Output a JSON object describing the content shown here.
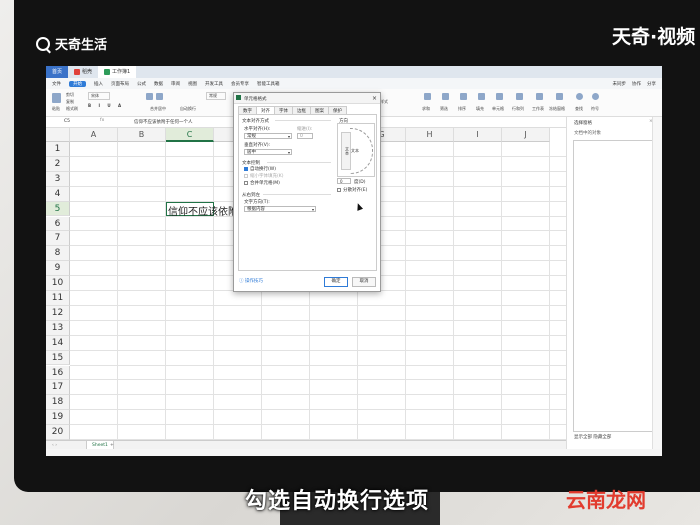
{
  "brand": {
    "top_left": "天奇生活",
    "top_right": "天奇·视频"
  },
  "tabs": [
    {
      "label": "首页"
    },
    {
      "label": "稻壳"
    },
    {
      "label": "工作簿1"
    }
  ],
  "menu": {
    "start": "开始",
    "items": [
      "文件",
      "插入",
      "页面布局",
      "公式",
      "数据",
      "审阅",
      "视图",
      "开发工具",
      "会员专享",
      "智能工具箱"
    ],
    "right": [
      "未同步",
      "协作",
      "分享"
    ]
  },
  "ribbon": {
    "labels": [
      "粘贴",
      "剪切",
      "复制",
      "格式刷",
      "宋体",
      "合并居中",
      "自动换行",
      "常规",
      "条件格式",
      "表格样式",
      "求和",
      "筛选",
      "排序",
      "填充",
      "单元格",
      "行和列",
      "工作表",
      "冻结窗格",
      "查找",
      "符号"
    ]
  },
  "formula_bar": {
    "cell_ref": "C5",
    "fx": "fx",
    "content": "信仰不应该依附于任何一个人"
  },
  "grid": {
    "columns": [
      "A",
      "B",
      "C",
      "D",
      "E",
      "F",
      "G",
      "H",
      "I",
      "J"
    ],
    "rows": [
      "1",
      "2",
      "3",
      "4",
      "5",
      "6",
      "7",
      "8",
      "9",
      "10",
      "11",
      "12",
      "13",
      "14",
      "15",
      "16",
      "17",
      "18",
      "19",
      "20"
    ],
    "selected_col": "C",
    "selected_row": "5",
    "cell_text": "信仰不应该依附于任何一"
  },
  "sheetbar": {
    "sheet_name": "Sheet1",
    "add": "+"
  },
  "right_pane": {
    "title": "选择窗格",
    "hint": "文档中的对象",
    "footer": "显示全部  隐藏全部"
  },
  "dialog": {
    "title": "单元格格式",
    "close": "×",
    "tabs": [
      "数字",
      "对齐",
      "字体",
      "边框",
      "图案",
      "保护"
    ],
    "active_tab": "对齐",
    "text_align_section": "文本对齐方式",
    "horizontal_label": "水平对齐(H):",
    "horizontal_value": "常规",
    "indent_label": "缩进(I):",
    "indent_value": "0",
    "vertical_label": "垂直对齐(V):",
    "vertical_value": "居中",
    "text_control_section": "文本控制",
    "wrap_text": "自动换行(W)",
    "shrink_fit": "缩小字体填充(K)",
    "merge_cells": "合并单元格(M)",
    "rtl_section": "从右到左",
    "direction_label": "文字方向(T):",
    "direction_value": "根据内容",
    "orientation_label": "方向",
    "vertical_text": "文本",
    "horizontal_text": "文本",
    "degree_value": "0",
    "degree_label": "度(D)",
    "distributed": "分散对齐(E)",
    "tips": "操作技巧",
    "ok": "确定",
    "cancel": "取消",
    "wrap_checked": true
  },
  "subtitle": "勾选自动换行选项",
  "watermark": "云南龙网"
}
